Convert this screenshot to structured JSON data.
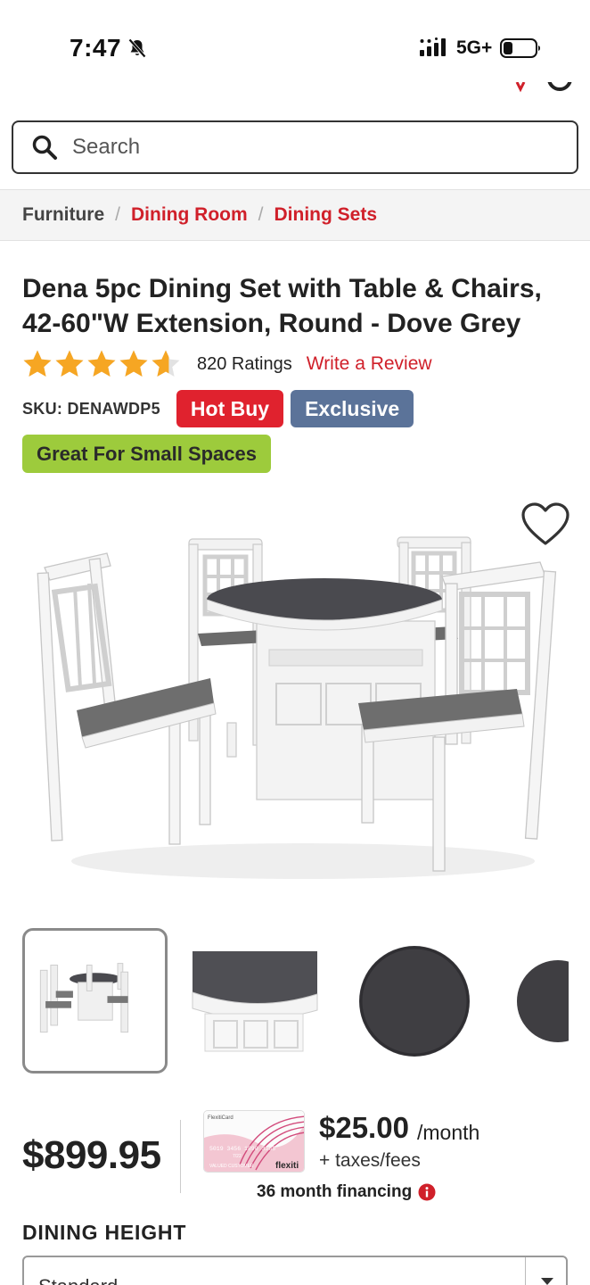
{
  "status_bar": {
    "time": "7:47",
    "network": "5G+",
    "icons": [
      "bell-slash-icon",
      "signal-icon",
      "battery-icon"
    ]
  },
  "search": {
    "placeholder": "Search"
  },
  "breadcrumb": {
    "items": [
      "Furniture",
      "Dining Room",
      "Dining Sets"
    ],
    "separator": "/"
  },
  "product": {
    "title": "Dena 5pc Dining Set with Table & Chairs, 42-60\"W Extension, Round - Dove Grey",
    "rating": 4.6,
    "rating_max": 5,
    "ratings_count": "820 Ratings",
    "write_review": "Write a Review",
    "sku": "SKU: DENAWDP5",
    "badges": {
      "hot_buy": "Hot Buy",
      "exclusive": "Exclusive",
      "small_spaces": "Great For Small Spaces"
    },
    "thumbnails_count": 4,
    "price": "$899.95",
    "financing": {
      "monthly": "$25.00",
      "per_month": "/month",
      "taxes": "+ taxes/fees",
      "term": "36 month financing",
      "card_brand": "flexiti",
      "card_label": "FlexitiCard",
      "card_number": "5019 3456 1890 3365",
      "card_holder": "VALUED CUSTOMER",
      "card_expiry": "7/22"
    },
    "dining_height": {
      "label": "DINING HEIGHT",
      "value": "Standard"
    }
  },
  "colors": {
    "accent_red": "#d0202a",
    "hot_buy": "#e0222e",
    "exclusive": "#5b7399",
    "small_spaces": "#9dcb3c",
    "star": "#f6a623"
  }
}
